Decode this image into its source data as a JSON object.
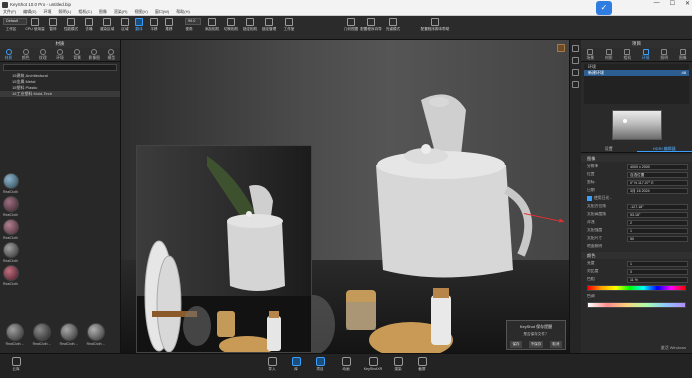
{
  "titlebar": {
    "title": "KeyShot 10.0 Pro - untitled.bip",
    "minimize": "—",
    "maximize": "☐",
    "close": "✕"
  },
  "menu": [
    "文件(F)",
    "编辑(E)",
    "环境",
    "照明(L)",
    "相机(C)",
    "图像",
    "渲染(R)",
    "视图(V)",
    "窗口(W)",
    "帮助(H)"
  ],
  "toolbar": {
    "preset": "Default",
    "zoom": "99.0",
    "buttons": [
      "工作区",
      "CPU 使用量",
      "暂停",
      "性能模式",
      "去噪",
      "渲染区域",
      "区域",
      "翻译",
      "平移",
      "推移",
      "视角",
      "添加相机",
      "切换相机",
      "锁定相机",
      "锁定管理",
      "工作室",
      "几何视图",
      "配置程序向导",
      "光谱模式",
      "配置程序脚本帮助"
    ]
  },
  "left_panel": {
    "title": "材质",
    "tabs": [
      "材质",
      "颜色",
      "纹理",
      "环境",
      "背景",
      "影像图",
      "模型"
    ],
    "tree": [
      "15建筑 Architectural",
      "15金属 Metal",
      "15塑料 Plastic",
      "16工业塑料 Mold-Tech"
    ],
    "thumbs": [
      "RealCloth",
      "RealCloth",
      "RealCloth",
      "RealCloth",
      "RealCloth",
      "RealCloth",
      "RealCloth"
    ],
    "bottom_thumbs": [
      "RealCloth ...",
      "RealCloth ...",
      "RealCloth ...",
      "RealCloth ..."
    ]
  },
  "right_panel": {
    "title": "项目",
    "tabs": [
      "场景",
      "材质",
      "相机",
      "环境",
      "照明",
      "图像"
    ],
    "env_list": [
      {
        "name": "环境",
        "badge": ""
      },
      {
        "name": "新建环境",
        "badge": "48"
      }
    ],
    "subtabs": [
      "设置",
      "HDRI 编辑器"
    ],
    "sections": {
      "image": "图像",
      "color": "颜色"
    },
    "props": [
      {
        "k": "分辨率",
        "v": "4000 x 2000"
      },
      {
        "k": "位置",
        "v": "自选位置"
      },
      {
        "k": "坐标",
        "v": "0° N 117.07° E"
      },
      {
        "k": "日期",
        "v": "3月 16 2024"
      },
      {
        "k": "",
        "v": "使用日光..."
      },
      {
        "k": "太阳方位角",
        "v": "-127.18°"
      },
      {
        "k": "太阳高度角",
        "v": "53.16°"
      },
      {
        "k": "浑浊",
        "v": "2"
      },
      {
        "k": "太阳强度",
        "v": "1"
      },
      {
        "k": "太阳尺寸",
        "v": "50"
      },
      {
        "k": "地面照明",
        "v": ""
      }
    ],
    "color_props": [
      {
        "k": "亮度",
        "v": "1"
      },
      {
        "k": "对比度",
        "v": "0"
      }
    ],
    "hue_label": "色相",
    "hue_value": "11 %",
    "tint_label": "色调",
    "watermark": "激活 Windows"
  },
  "dialog": {
    "title": "KeyShot 保存提醒",
    "message": "是否保存文件？",
    "buttons": [
      "保存",
      "不保存",
      "取消"
    ]
  },
  "bottom_bar": [
    "导入",
    "库",
    "项目",
    "动画",
    "KeyShotXR",
    "渲染",
    "截屏"
  ],
  "bottom_left": "云库"
}
